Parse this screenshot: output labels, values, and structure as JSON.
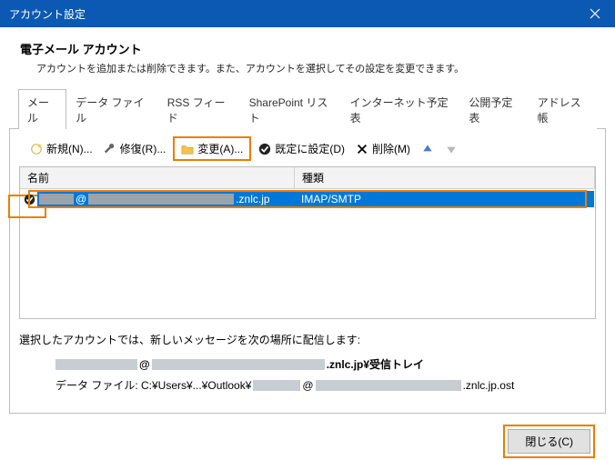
{
  "window": {
    "title": "アカウント設定"
  },
  "header": {
    "title": "電子メール アカウント",
    "subtitle": "アカウントを追加または削除できます。また、アカウントを選択してその設定を変更できます。"
  },
  "tabs": {
    "items": [
      {
        "label": "メール",
        "active": true
      },
      {
        "label": "データ ファイル"
      },
      {
        "label": "RSS フィード"
      },
      {
        "label": "SharePoint リスト"
      },
      {
        "label": "インターネット予定表"
      },
      {
        "label": "公開予定表"
      },
      {
        "label": "アドレス帳"
      }
    ]
  },
  "toolbar": {
    "new": "新規(N)...",
    "repair": "修復(R)...",
    "change": "変更(A)...",
    "setdefault": "既定に設定(D)",
    "delete": "削除(M)"
  },
  "list": {
    "col_name": "名前",
    "col_type": "種類",
    "row": {
      "name_suffix": ".znlc.jp",
      "type": "IMAP/SMTP"
    }
  },
  "delivery": {
    "label": "選択したアカウントでは、新しいメッセージを次の場所に配信します:",
    "line1_suffix": ".znlc.jp¥受信トレイ",
    "line2_prefix": "データ ファイル: C:¥Users¥...¥Outlook¥",
    "line2_suffix": ".znlc.jp.ost"
  },
  "footer": {
    "close": "閉じる(C)"
  }
}
